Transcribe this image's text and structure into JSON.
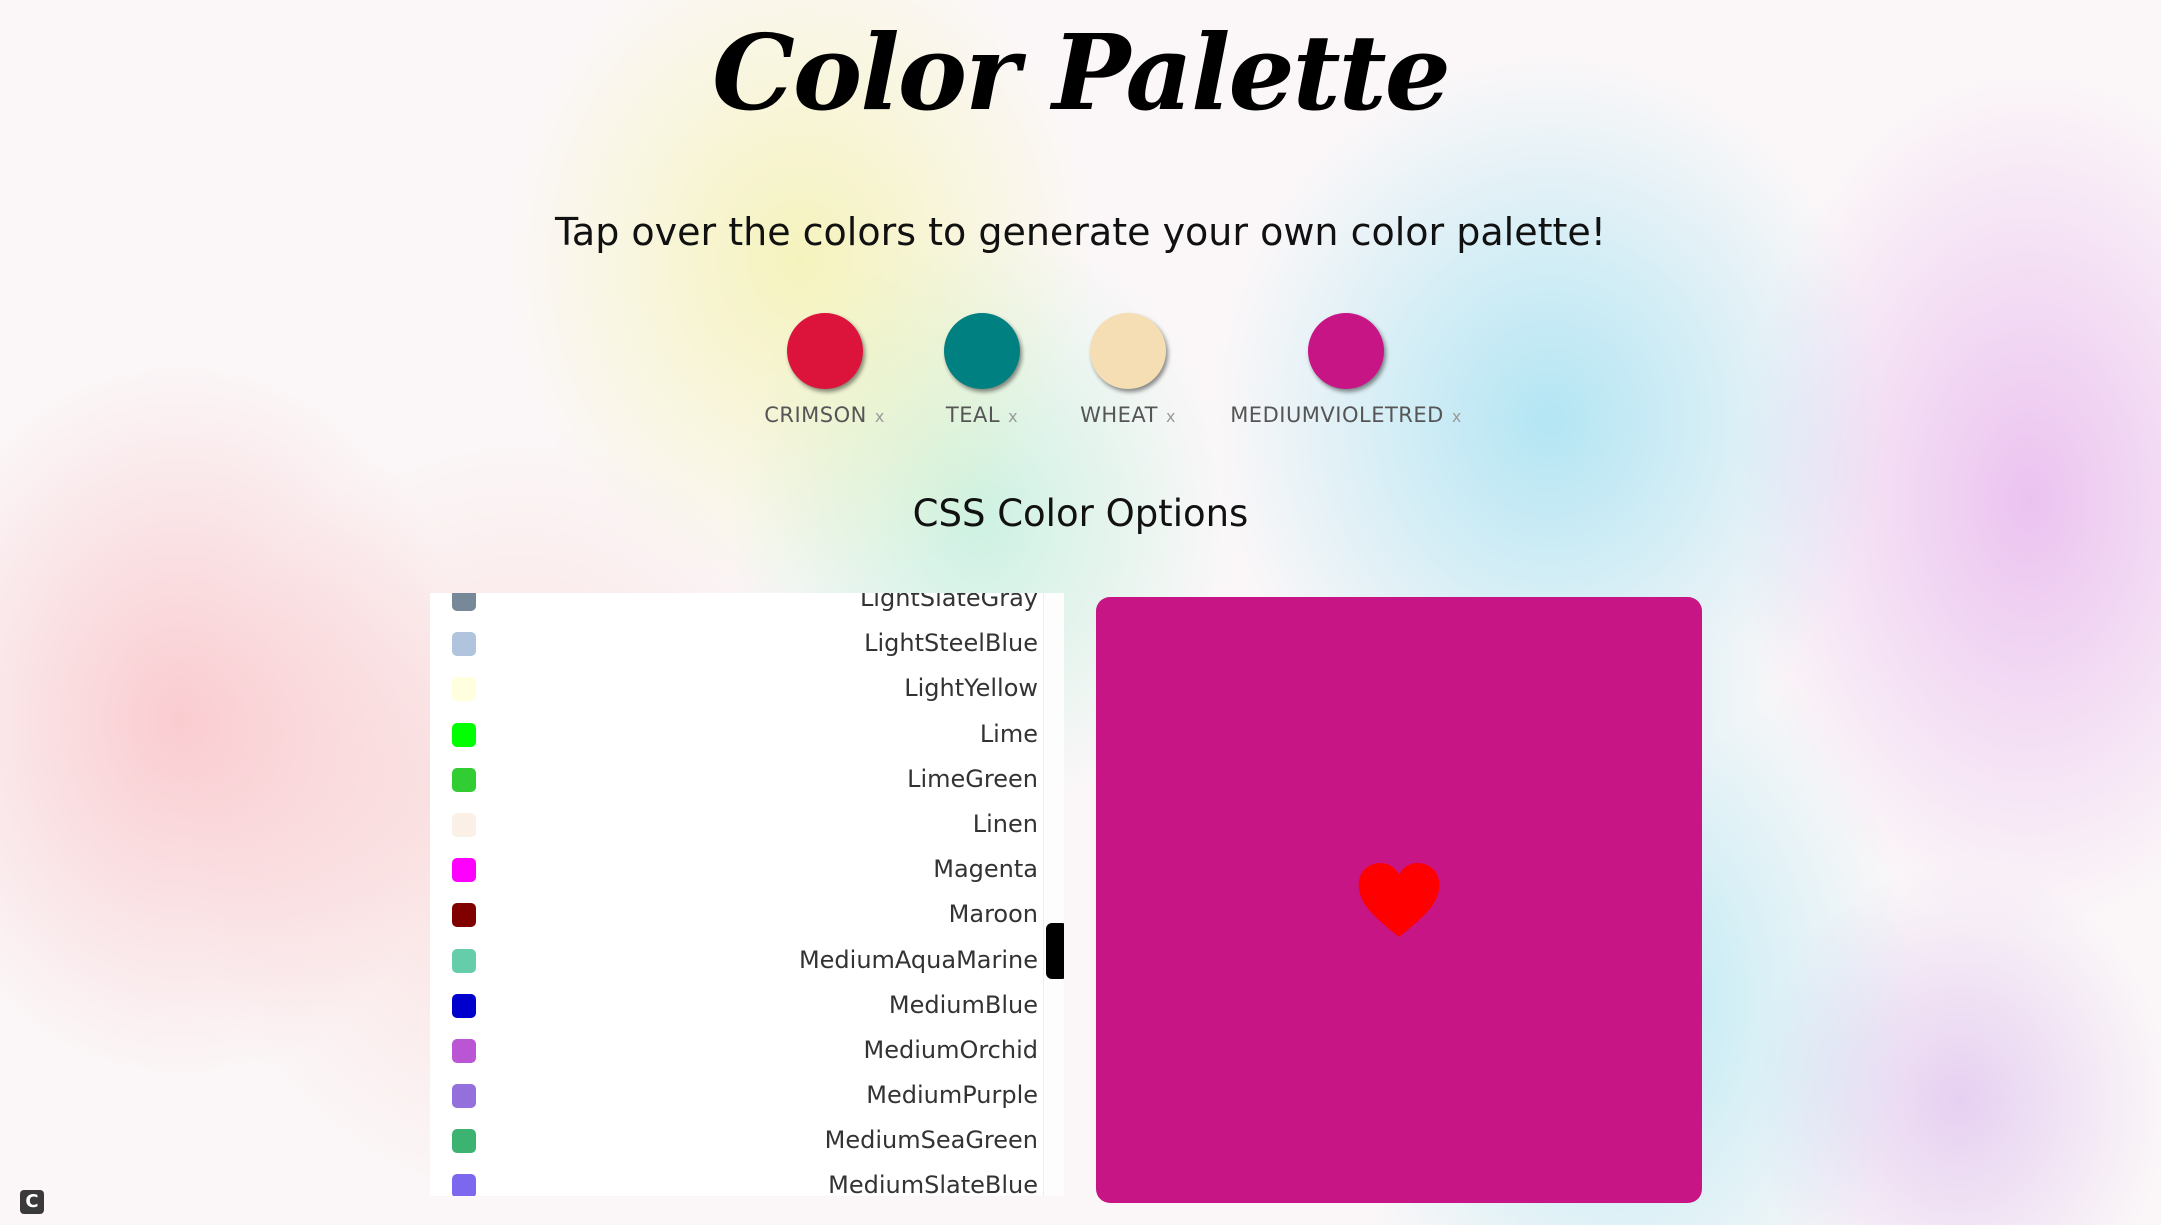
{
  "header": {
    "title": "Color Palette",
    "subtitle": "Tap over the colors to generate your own color palette!"
  },
  "palette": [
    {
      "label": "CRIMSON",
      "color": "#DC143C",
      "remove": "x"
    },
    {
      "label": "TEAL",
      "color": "#008080",
      "remove": "x"
    },
    {
      "label": "WHEAT",
      "color": "#F5DEB3",
      "remove": "x"
    },
    {
      "label": "MEDIUMVIOLETRED",
      "color": "#C71585",
      "remove": "x"
    }
  ],
  "options": {
    "title": "CSS Color Options",
    "items": [
      {
        "name": "LightSlateGray",
        "color": "#778899"
      },
      {
        "name": "LightSteelBlue",
        "color": "#B0C4DE"
      },
      {
        "name": "LightYellow",
        "color": "#FFFFE0"
      },
      {
        "name": "Lime",
        "color": "#00FF00"
      },
      {
        "name": "LimeGreen",
        "color": "#32CD32"
      },
      {
        "name": "Linen",
        "color": "#FAF0E6"
      },
      {
        "name": "Magenta",
        "color": "#FF00FF"
      },
      {
        "name": "Maroon",
        "color": "#800000"
      },
      {
        "name": "MediumAquaMarine",
        "color": "#66CDAA"
      },
      {
        "name": "MediumBlue",
        "color": "#0000CD"
      },
      {
        "name": "MediumOrchid",
        "color": "#BA55D3"
      },
      {
        "name": "MediumPurple",
        "color": "#9370DB"
      },
      {
        "name": "MediumSeaGreen",
        "color": "#3CB371"
      },
      {
        "name": "MediumSlateBlue",
        "color": "#7B68EE"
      }
    ]
  },
  "preview": {
    "background": "#C71585",
    "icon": "heart-icon",
    "icon_color": "#FF0000"
  },
  "corner_badge": {
    "icon": "c-logo-icon",
    "text": "C"
  }
}
